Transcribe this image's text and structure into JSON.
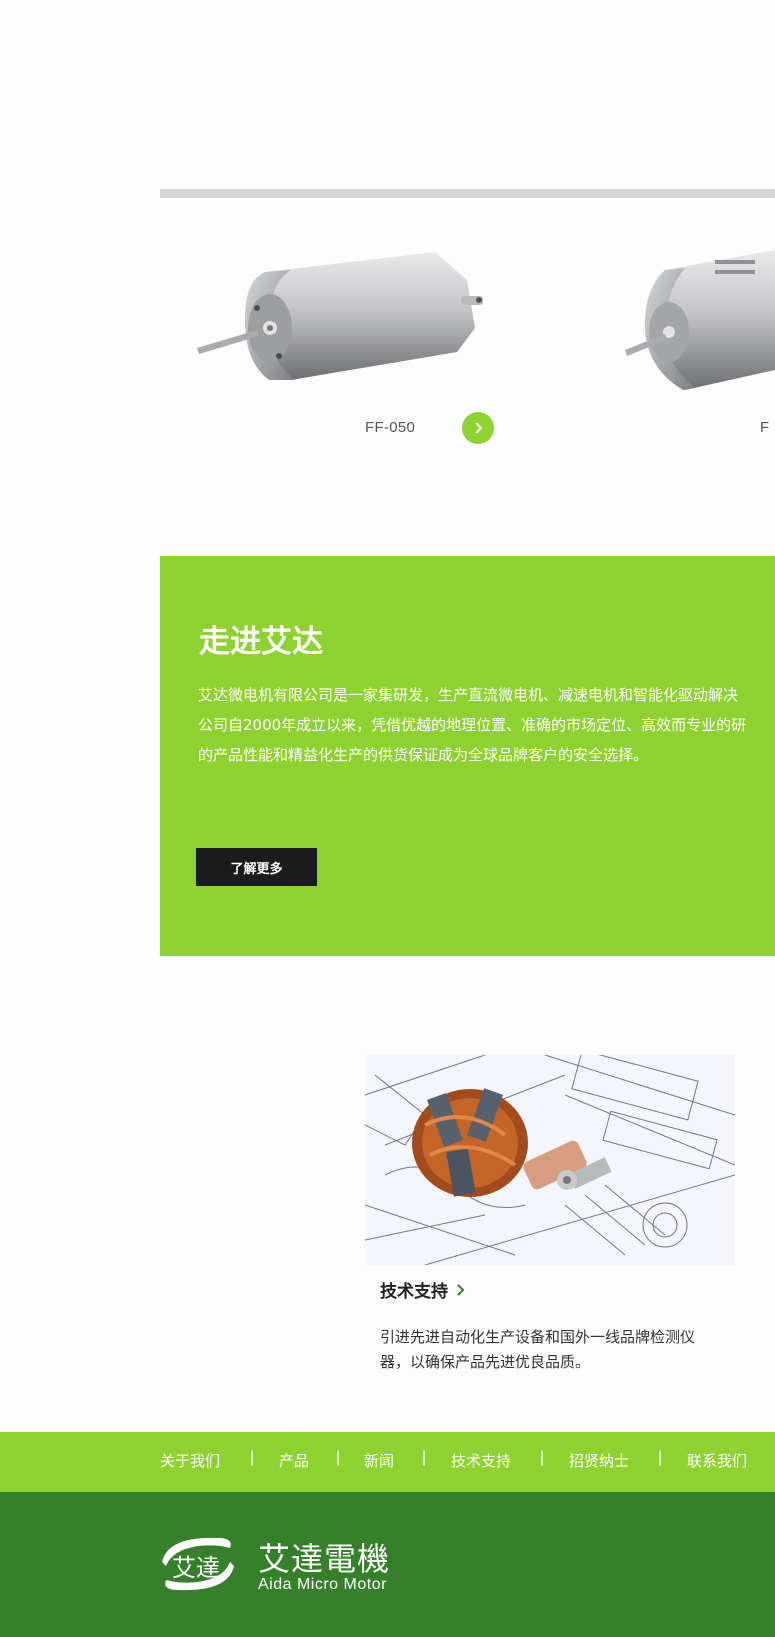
{
  "colors": {
    "accent": "#8dd230",
    "dark_green": "#367f2b",
    "button_dark": "#1b1b1b",
    "track": "#d6d6d6"
  },
  "products": [
    {
      "label": "FF-050",
      "arrow_icon": "chevron-right-icon"
    },
    {
      "label": "F"
    }
  ],
  "about": {
    "title": "走进艾达",
    "lines": [
      "艾达微电机有限公司是一家集研发，生产直流微电机、减速电机和智能化驱动解决",
      "公司自2000年成立以来，凭借优越的地理位置、准确的市场定位、高效而专业的研",
      "的产品性能和精益化生产的供货保证成为全球品牌客户的安全选择。"
    ],
    "more_button": "了解更多"
  },
  "tech": {
    "title": "技术支持",
    "title_icon": "chevron-right-icon",
    "description": "引进先进自动化生产设备和国外一线品牌检测仪器，以确保产品先进优良品质。"
  },
  "footer_nav": [
    "关于我们",
    "产品",
    "新闻",
    "技术支持",
    "招贤纳士",
    "联系我们"
  ],
  "footer_separator": "|",
  "brand": {
    "logo_text": "艾達",
    "name_cn": "艾達電機",
    "name_en": "Aida Micro Motor"
  }
}
